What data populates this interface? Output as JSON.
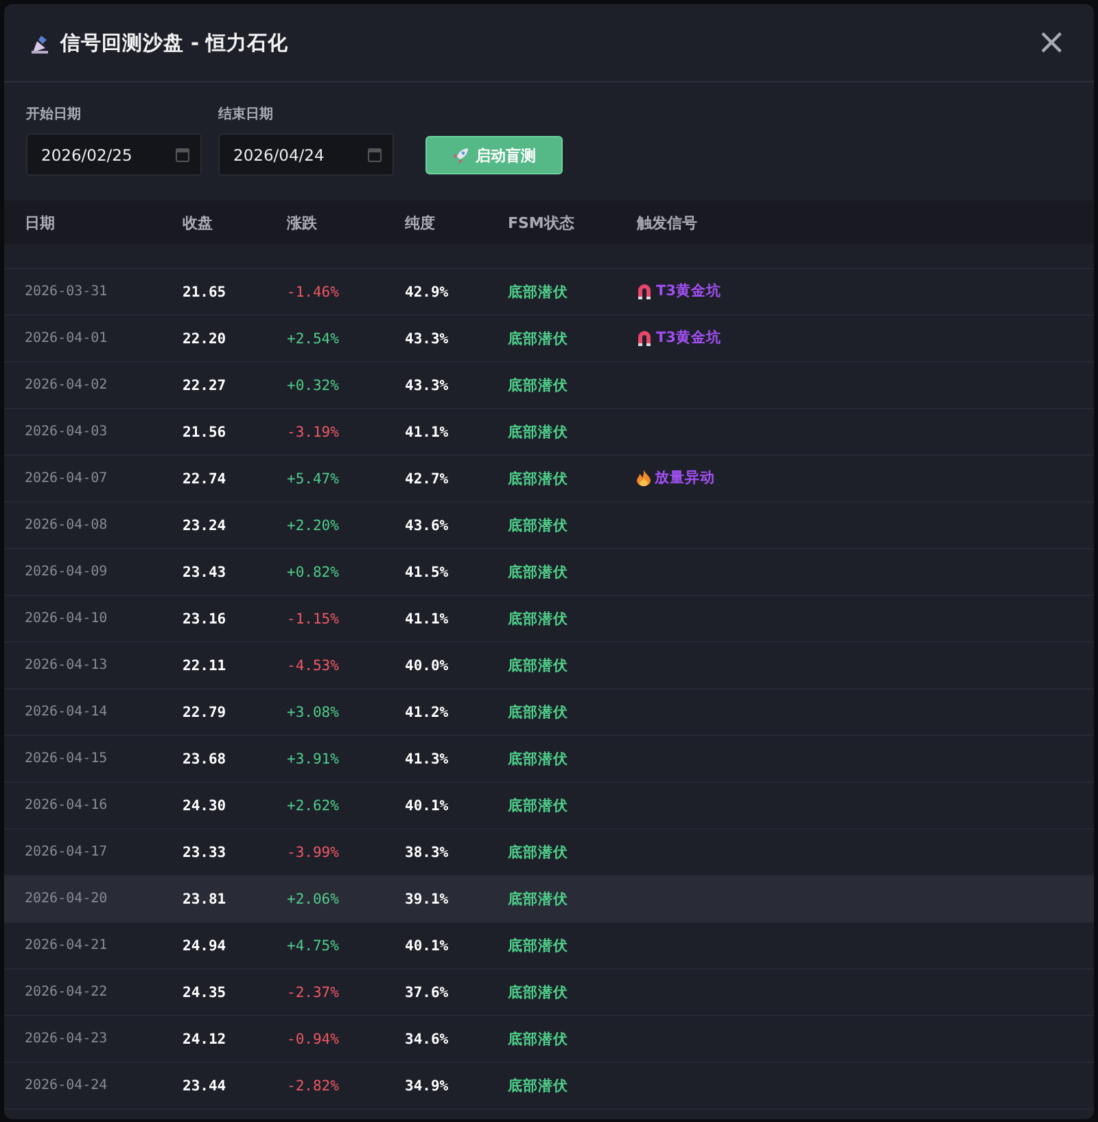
{
  "dialog": {
    "title": "信号回测沙盘 - 恒力石化",
    "close": "×"
  },
  "controls": {
    "start": {
      "label": "开始日期",
      "value": "2026/02/25"
    },
    "end": {
      "label": "结束日期",
      "value": "2026/04/24"
    },
    "button": "启动盲测"
  },
  "table": {
    "columns": [
      "日期",
      "收盘",
      "涨跌",
      "纯度",
      "FSM状态",
      "触发信号"
    ],
    "rows": [
      {
        "date": "2026-03-31",
        "close": "21.65",
        "change": "-1.46%",
        "rising": false,
        "purity": "42.9%",
        "state": "底部潜伏",
        "signal": {
          "kind": "magnet",
          "text": "T3黄金坑"
        },
        "hovered": false
      },
      {
        "date": "2026-04-01",
        "close": "22.20",
        "change": "+2.54%",
        "rising": true,
        "purity": "43.3%",
        "state": "底部潜伏",
        "signal": {
          "kind": "magnet",
          "text": "T3黄金坑"
        },
        "hovered": false
      },
      {
        "date": "2026-04-02",
        "close": "22.27",
        "change": "+0.32%",
        "rising": true,
        "purity": "43.3%",
        "state": "底部潜伏",
        "hovered": false
      },
      {
        "date": "2026-04-03",
        "close": "21.56",
        "change": "-3.19%",
        "rising": false,
        "purity": "41.1%",
        "state": "底部潜伏",
        "hovered": false
      },
      {
        "date": "2026-04-07",
        "close": "22.74",
        "change": "+5.47%",
        "rising": true,
        "purity": "42.7%",
        "state": "底部潜伏",
        "signal": {
          "kind": "fire",
          "text": "放量异动"
        },
        "hovered": false
      },
      {
        "date": "2026-04-08",
        "close": "23.24",
        "change": "+2.20%",
        "rising": true,
        "purity": "43.6%",
        "state": "底部潜伏",
        "hovered": false
      },
      {
        "date": "2026-04-09",
        "close": "23.43",
        "change": "+0.82%",
        "rising": true,
        "purity": "41.5%",
        "state": "底部潜伏",
        "hovered": false
      },
      {
        "date": "2026-04-10",
        "close": "23.16",
        "change": "-1.15%",
        "rising": false,
        "purity": "41.1%",
        "state": "底部潜伏",
        "hovered": false
      },
      {
        "date": "2026-04-13",
        "close": "22.11",
        "change": "-4.53%",
        "rising": false,
        "purity": "40.0%",
        "state": "底部潜伏",
        "hovered": false
      },
      {
        "date": "2026-04-14",
        "close": "22.79",
        "change": "+3.08%",
        "rising": true,
        "purity": "41.2%",
        "state": "底部潜伏",
        "hovered": false
      },
      {
        "date": "2026-04-15",
        "close": "23.68",
        "change": "+3.91%",
        "rising": true,
        "purity": "41.3%",
        "state": "底部潜伏",
        "hovered": false
      },
      {
        "date": "2026-04-16",
        "close": "24.30",
        "change": "+2.62%",
        "rising": true,
        "purity": "40.1%",
        "state": "底部潜伏",
        "hovered": false
      },
      {
        "date": "2026-04-17",
        "close": "23.33",
        "change": "-3.99%",
        "rising": false,
        "purity": "38.3%",
        "state": "底部潜伏",
        "hovered": false
      },
      {
        "date": "2026-04-20",
        "close": "23.81",
        "change": "+2.06%",
        "rising": true,
        "purity": "39.1%",
        "state": "底部潜伏",
        "hovered": true
      },
      {
        "date": "2026-04-21",
        "close": "24.94",
        "change": "+4.75%",
        "rising": true,
        "purity": "40.1%",
        "state": "底部潜伏",
        "hovered": false
      },
      {
        "date": "2026-04-22",
        "close": "24.35",
        "change": "-2.37%",
        "rising": false,
        "purity": "37.6%",
        "state": "底部潜伏",
        "hovered": false
      },
      {
        "date": "2026-04-23",
        "close": "24.12",
        "change": "-0.94%",
        "rising": false,
        "purity": "34.6%",
        "state": "底部潜伏",
        "hovered": false
      },
      {
        "date": "2026-04-24",
        "close": "23.44",
        "change": "-2.82%",
        "rising": false,
        "purity": "34.9%",
        "state": "底部潜伏",
        "hovered": false
      }
    ]
  }
}
